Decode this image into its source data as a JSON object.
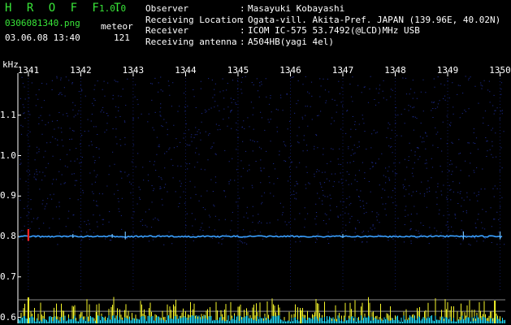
{
  "header": {
    "app_title": "H R O F F T",
    "version": "1.0.0",
    "filename": "0306081340.png",
    "mode": "meteor",
    "datetime": "03.06.08 13:40",
    "count": "121"
  },
  "info": [
    {
      "label": "Observer",
      "value": "Masayuki Kobayashi"
    },
    {
      "label": "Receiving Location",
      "value": "Ogata-vill. Akita-Pref. JAPAN (139.96E, 40.02N)"
    },
    {
      "label": "Receiver",
      "value": "ICOM IC-575 53.7492(@LCD)MHz USB"
    },
    {
      "label": "Receiving antenna",
      "value": "A504HB(yagi 4el)"
    }
  ],
  "colors": {
    "background": "#000000",
    "header_green": "#39e639",
    "grid": "#1a2a9a",
    "echo_line": "#3aa0ff",
    "peak": "#ff2020",
    "histogram_yellow": "#f5f52a",
    "histogram_cyan": "#20e0ff"
  },
  "chart_data": {
    "type": "heatmap",
    "ylabel": "kHz",
    "x_tick_labels": [
      "1341",
      "1342",
      "1343",
      "1344",
      "1345",
      "1346",
      "1347",
      "1348",
      "1349",
      "1350"
    ],
    "y_tick_labels": [
      "1.1",
      "1.0",
      "0.9",
      "0.8",
      "0.7",
      "0.6"
    ],
    "y_ticks": [
      1.1,
      1.0,
      0.9,
      0.8,
      0.7,
      0.6
    ],
    "ylim": [
      0.585,
      1.2
    ],
    "xlim": [
      1340.8,
      1350.1
    ],
    "x_ticks": [
      1341,
      1342,
      1343,
      1344,
      1345,
      1346,
      1347,
      1348,
      1349,
      1350
    ],
    "carrier_khz": 0.8,
    "echo_events": [
      {
        "time": 1341.0,
        "strength": "strong"
      },
      {
        "time": 1341.85,
        "strength": "weak"
      },
      {
        "time": 1342.6,
        "strength": "weak"
      },
      {
        "time": 1342.85,
        "strength": "medium"
      },
      {
        "time": 1347.0,
        "strength": "weak"
      },
      {
        "time": 1349.3,
        "strength": "medium"
      },
      {
        "time": 1350.0,
        "strength": "medium"
      }
    ],
    "histogram_threshold_khz": 0.615
  }
}
